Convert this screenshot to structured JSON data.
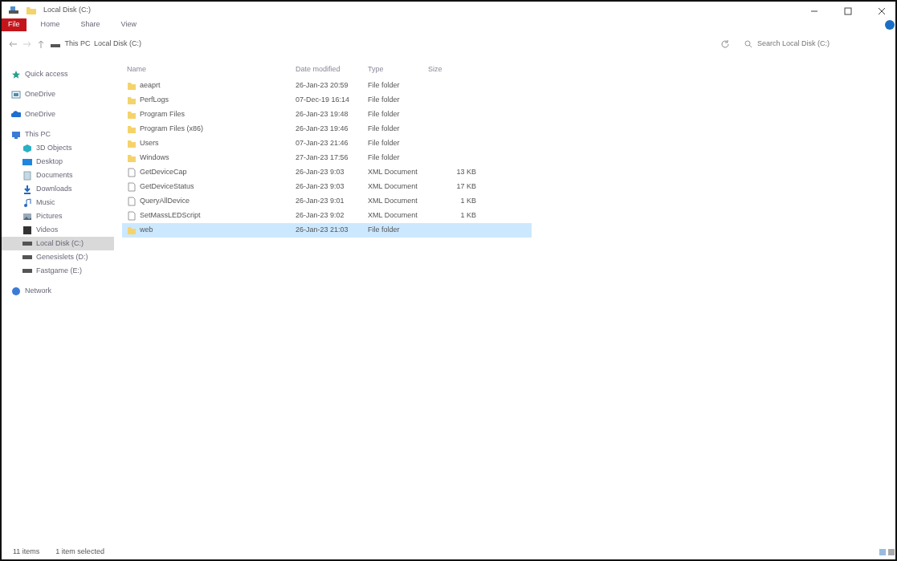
{
  "window": {
    "title": "Local Disk (C:)"
  },
  "ribbon_tabs": [
    {
      "label": "File",
      "selected": true
    },
    {
      "label": "Home",
      "selected": false
    },
    {
      "label": "Share",
      "selected": false
    },
    {
      "label": "View",
      "selected": false
    }
  ],
  "breadcrumb": [
    "This PC",
    "Local Disk (C:)"
  ],
  "search": {
    "placeholder": "Search Local Disk (C:)"
  },
  "sidebar": {
    "items": [
      {
        "label": "Quick access",
        "kind": "star",
        "selected": false
      },
      {
        "label": "OneDrive",
        "kind": "box",
        "selected": false
      },
      {
        "label": "OneDrive",
        "kind": "cloud",
        "selected": false
      },
      {
        "label": "This PC",
        "kind": "pc",
        "selected": false,
        "children": [
          {
            "label": "3D Objects",
            "kind": "cube",
            "selected": false
          },
          {
            "label": "Desktop",
            "kind": "desktop",
            "selected": false
          },
          {
            "label": "Documents",
            "kind": "doc",
            "selected": false
          },
          {
            "label": "Downloads",
            "kind": "down",
            "selected": false
          },
          {
            "label": "Music",
            "kind": "music",
            "selected": false
          },
          {
            "label": "Pictures",
            "kind": "pic",
            "selected": false
          },
          {
            "label": "Videos",
            "kind": "video",
            "selected": false
          },
          {
            "label": "Local Disk (C:)",
            "kind": "drive",
            "selected": true
          },
          {
            "label": "Genesislets (D:)",
            "kind": "drive",
            "selected": false
          },
          {
            "label": "Fastgame (E:)",
            "kind": "drive",
            "selected": false
          }
        ]
      },
      {
        "label": "Network",
        "kind": "network",
        "selected": false
      }
    ]
  },
  "table": {
    "columns": [
      "Name",
      "Date modified",
      "Type",
      "Size"
    ],
    "rows": [
      {
        "kind": "folder",
        "name": "aeaprt",
        "date": "26-Jan-23 20:59",
        "type": "File folder",
        "selected": false
      },
      {
        "kind": "folder",
        "name": "PerfLogs",
        "date": "07-Dec-19 16:14",
        "type": "File folder",
        "selected": false
      },
      {
        "kind": "folder",
        "name": "Program Files",
        "date": "26-Jan-23 19:48",
        "type": "File folder",
        "selected": false
      },
      {
        "kind": "folder",
        "name": "Program Files (x86)",
        "date": "26-Jan-23 19:46",
        "type": "File folder",
        "selected": false
      },
      {
        "kind": "folder",
        "name": "Users",
        "date": "07-Jan-23 21:46",
        "type": "File folder",
        "selected": false
      },
      {
        "kind": "folder",
        "name": "Windows",
        "date": "27-Jan-23 17:56",
        "type": "File folder",
        "selected": false
      },
      {
        "kind": "file",
        "name": "GetDeviceCap",
        "date": "26-Jan-23 9:03",
        "type": "XML Document",
        "size": "13 KB",
        "selected": false
      },
      {
        "kind": "file",
        "name": "GetDeviceStatus",
        "date": "26-Jan-23 9:03",
        "type": "XML Document",
        "size": "17 KB",
        "selected": false
      },
      {
        "kind": "file",
        "name": "QueryAllDevice",
        "date": "26-Jan-23 9:01",
        "type": "XML Document",
        "size": "1 KB",
        "selected": false
      },
      {
        "kind": "file",
        "name": "SetMassLEDScript",
        "date": "26-Jan-23 9:02",
        "type": "XML Document",
        "size": "1 KB",
        "selected": false
      },
      {
        "kind": "folder",
        "name": "web",
        "date": "26-Jan-23 21:03",
        "type": "File folder",
        "selected": true
      }
    ]
  },
  "status_bar": {
    "count": "11 items",
    "selection": "1 item selected"
  }
}
